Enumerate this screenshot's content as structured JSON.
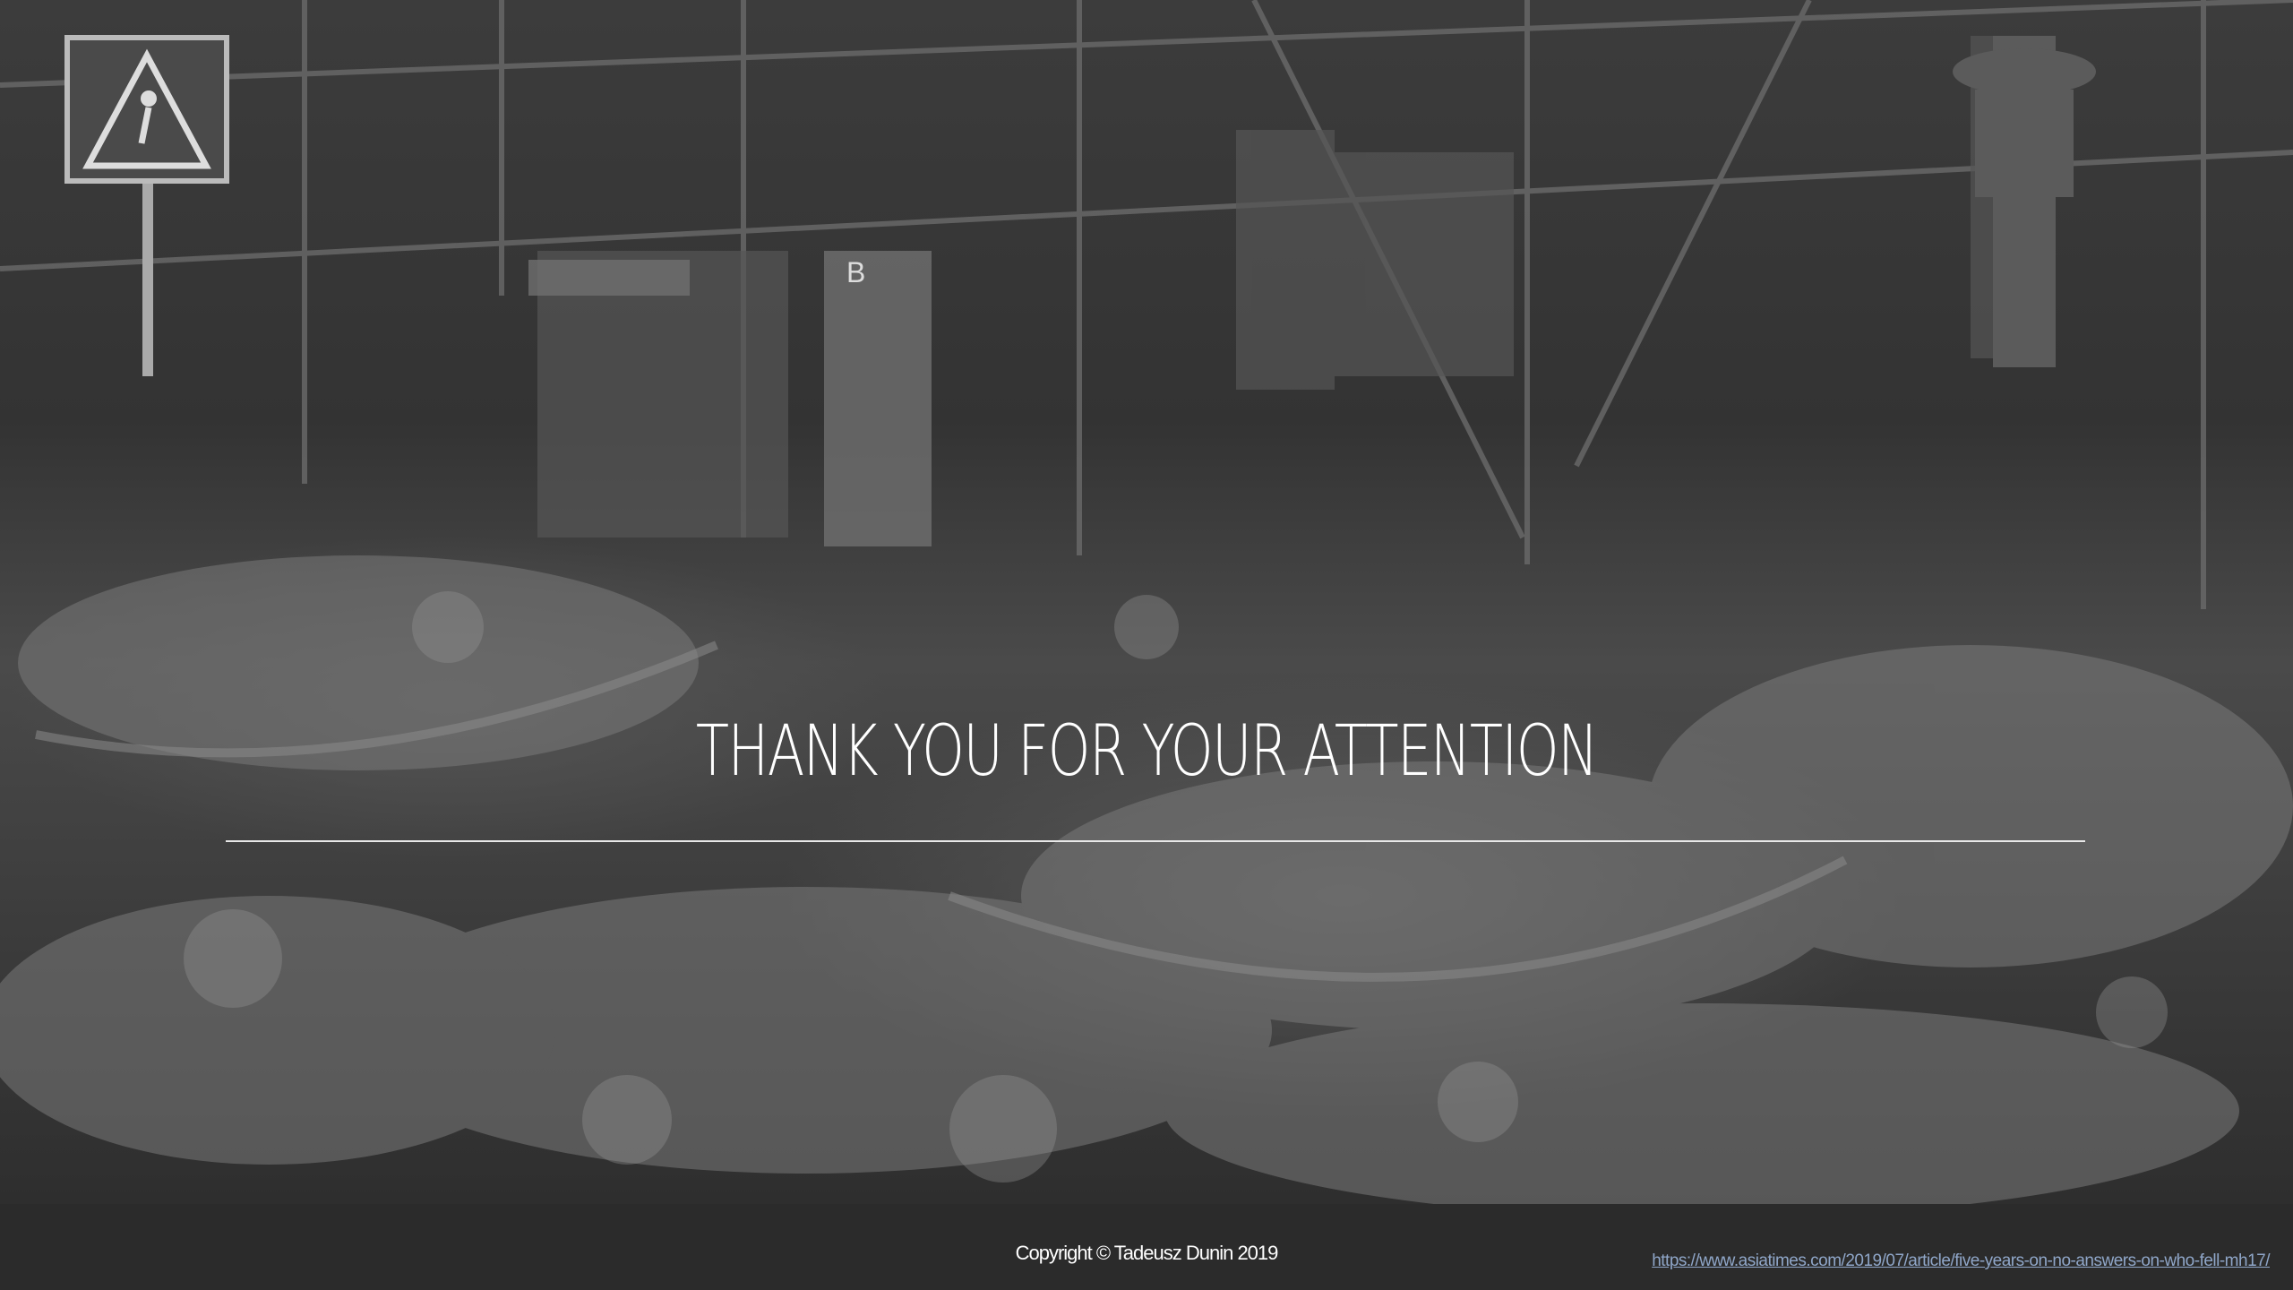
{
  "slide": {
    "title": "THANK YOU FOR YOUR ATTENTION",
    "copyright": "Copyright © Tadeusz Dunin 2019",
    "source_url": "https://www.asiatimes.com/2019/07/article/five-years-on-no-answers-on-who-fell-mh17/"
  },
  "background_photo": {
    "sign_letter": "B"
  },
  "colors": {
    "title_text": "#ffffff",
    "divider": "#e8e8e8",
    "footer_bg": "#2b2b2b",
    "link": "#8fa6c8"
  }
}
